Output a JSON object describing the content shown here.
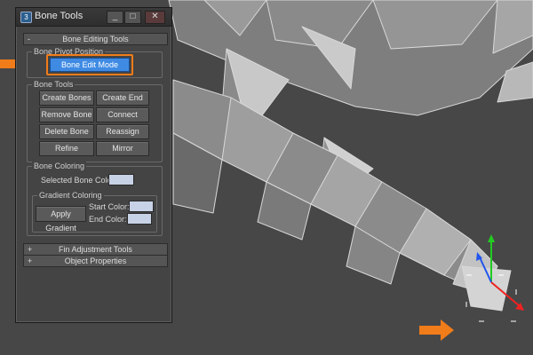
{
  "window": {
    "title": "Bone Tools",
    "min_glyph": "_",
    "max_glyph": "□",
    "close_glyph": "✕"
  },
  "rollouts": {
    "bone_editing": {
      "sign": "-",
      "label": "Bone Editing Tools"
    },
    "fin_adjustment": {
      "sign": "+",
      "label": "Fin Adjustment Tools"
    },
    "object_properties": {
      "sign": "+",
      "label": "Object Properties"
    }
  },
  "bone_pivot": {
    "group_label": "Bone Pivot Position",
    "edit_mode_label": "Bone Edit Mode"
  },
  "bone_tools": {
    "group_label": "Bone Tools",
    "create_bones": "Create Bones",
    "create_end": "Create End",
    "remove_bone": "Remove Bone",
    "connect_bones": "Connect Bones",
    "delete_bone": "Delete Bone",
    "reassign_root": "Reassign Root",
    "refine": "Refine",
    "mirror": "Mirror"
  },
  "bone_coloring": {
    "group_label": "Bone Coloring",
    "selected_color_label": "Selected Bone Color:",
    "gradient_group_label": "Gradient Coloring",
    "apply_gradient": "Apply Gradient",
    "start_color_label": "Start Color:",
    "end_color_label": "End Color:"
  },
  "colors": {
    "accent_active": "#3f8be4",
    "highlight_orange": "#f07c1a",
    "swatch": "#c7d2e6"
  }
}
